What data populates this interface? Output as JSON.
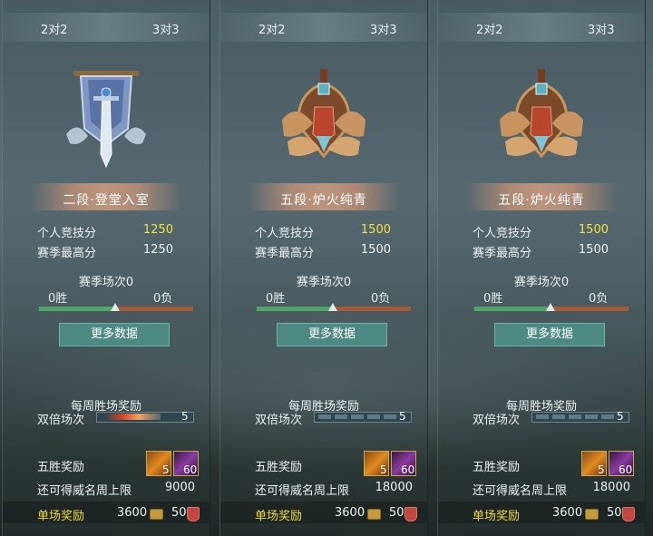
{
  "panels": [
    {
      "tab_left": "2对2",
      "tab_right": "3对3",
      "emblem_icon": "silver-banner-sword-icon",
      "rank_name": "二段·登堂入室",
      "personal_label": "个人竞技分",
      "personal_value": "1250",
      "season_label": "赛季最高分",
      "season_value": "1250",
      "season_matches": "赛季场次0",
      "wins": "0胜",
      "losses": "0负",
      "more_button": "更多数据",
      "weekly_title": "每周胜场奖励",
      "double_label": "双倍场次",
      "double_count": "5",
      "five_win_label": "五胜奖励",
      "item1_count": "5",
      "item2_count": "60",
      "fame_label": "还可得威名周上限",
      "fame_value": "9000",
      "single_label": "单场奖励",
      "coin_value": "3600",
      "shield_value": "50"
    },
    {
      "tab_left": "2对2",
      "tab_right": "3对3",
      "emblem_icon": "golden-wings-sword-icon",
      "rank_name": "五段·炉火纯青",
      "personal_label": "个人竞技分",
      "personal_value": "1500",
      "season_label": "赛季最高分",
      "season_value": "1500",
      "season_matches": "赛季场次0",
      "wins": "0胜",
      "losses": "0负",
      "more_button": "更多数据",
      "weekly_title": "每周胜场奖励",
      "double_label": "双倍场次",
      "double_count": "5",
      "five_win_label": "五胜奖励",
      "item1_count": "5",
      "item2_count": "60",
      "fame_label": "还可得威名周上限",
      "fame_value": "18000",
      "single_label": "单场奖励",
      "coin_value": "3600",
      "shield_value": "50"
    },
    {
      "tab_left": "2对2",
      "tab_right": "3对3",
      "emblem_icon": "golden-wings-sword-icon",
      "rank_name": "五段·炉火纯青",
      "personal_label": "个人竞技分",
      "personal_value": "1500",
      "season_label": "赛季最高分",
      "season_value": "1500",
      "season_matches": "赛季场次0",
      "wins": "0胜",
      "losses": "0负",
      "more_button": "更多数据",
      "weekly_title": "每周胜场奖励",
      "double_label": "双倍场次",
      "double_count": "5",
      "five_win_label": "五胜奖励",
      "item1_count": "5",
      "item2_count": "60",
      "fame_label": "还可得威名周上限",
      "fame_value": "18000",
      "single_label": "单场奖励",
      "coin_value": "3600",
      "shield_value": "50"
    }
  ],
  "colors": {
    "accent_gold": "#f4e23a",
    "win_green": "#4fa86a",
    "loss_red": "#a55a3a",
    "button_teal": "#4e8a84"
  }
}
